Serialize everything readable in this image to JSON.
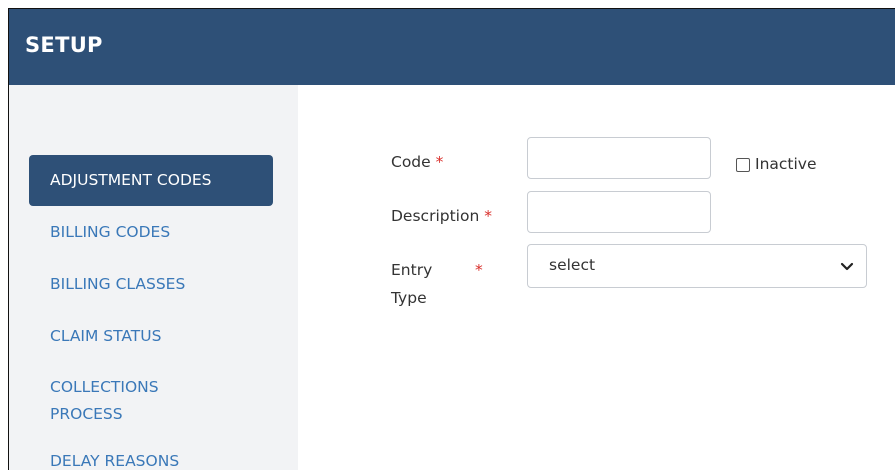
{
  "header": {
    "title": "SETUP"
  },
  "sidebar": {
    "items": [
      {
        "label": "ADJUSTMENT CODES",
        "active": true
      },
      {
        "label": "BILLING CODES"
      },
      {
        "label": "BILLING CLASSES"
      },
      {
        "label": "CLAIM STATUS"
      },
      {
        "label": "COLLECTIONS PROCESS"
      },
      {
        "label": "DELAY REASONS"
      }
    ]
  },
  "form": {
    "code_label": "Code",
    "description_label": "Description",
    "entry_label": "Entry",
    "type_label": "Type",
    "required_mark": "*",
    "code_value": "",
    "description_value": "",
    "inactive_label": "Inactive",
    "inactive_checked": false,
    "entry_type_selected": "select"
  },
  "colors": {
    "header_bg": "#2e5077",
    "active_item_bg": "#2e5077",
    "link_color": "#3a78b8",
    "required_color": "#d9302c",
    "sidebar_bg": "#f2f3f5"
  }
}
